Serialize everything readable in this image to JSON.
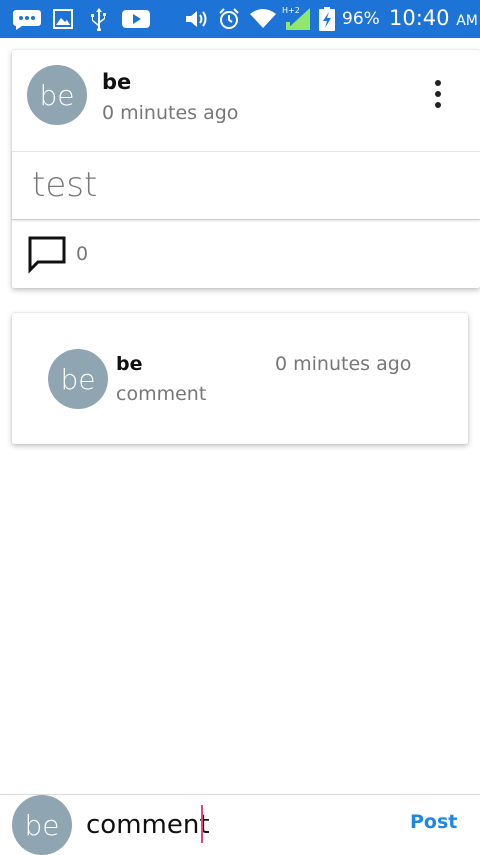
{
  "status_bar": {
    "battery_percent": "96%",
    "time": "10:40",
    "ampm": "AM",
    "background_color": "#1e74d6",
    "left_icons": [
      "messages-icon",
      "gallery-icon",
      "usb-icon",
      "youtube-icon"
    ],
    "right_icons": [
      "volume-icon",
      "alarm-icon",
      "wifi-icon",
      "signal-icon",
      "battery-charging-icon"
    ],
    "signal_label": "H+2"
  },
  "post": {
    "avatar_initials": "be",
    "username": "be",
    "time": "0 minutes ago",
    "text": "test",
    "comment_count": "0",
    "menu_icon": "more-vertical-icon",
    "comment_icon": "comment-icon"
  },
  "comments": [
    {
      "avatar_initials": "be",
      "username": "be",
      "time": "0 minutes ago",
      "text": "comment"
    }
  ],
  "composer": {
    "avatar_initials": "be",
    "input_value": "comment",
    "post_label": "Post",
    "post_color": "#1e88e5"
  },
  "colors": {
    "avatar_bg": "#8fa5b1",
    "caret": "#e0467c"
  }
}
